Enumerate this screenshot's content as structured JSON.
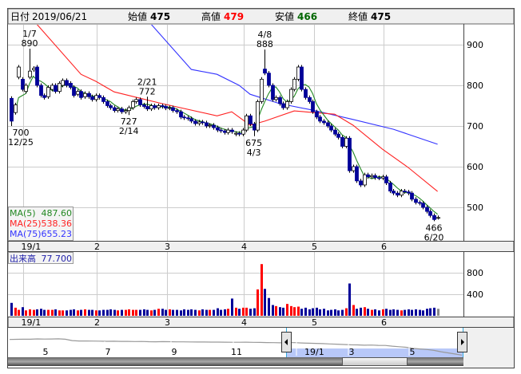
{
  "header": {
    "date_label": "日付",
    "date": "2019/06/21",
    "open_label": "始値",
    "open": "475",
    "high_label": "高値",
    "high": "479",
    "low_label": "安値",
    "low": "466",
    "close_label": "終値",
    "close": "475"
  },
  "colors": {
    "up_candle": "#ffffff",
    "down_candle": "#000099",
    "volume_up": "#ff0000",
    "volume_down": "#000099",
    "volume_flat": "#888888",
    "ma5": "#228822",
    "ma25": "#ff2222",
    "ma75": "#3333ff",
    "high_text": "#ff0000",
    "low_text": "#006600"
  },
  "legend": {
    "ma5_label": "MA(5)",
    "ma5_value": "487.60",
    "ma25_label": "MA(25)",
    "ma25_value": "538.36",
    "ma75_label": "MA(75)",
    "ma75_value": "655.23",
    "volume_label": "出来高",
    "volume_value": "77.700"
  },
  "chart_data": {
    "type": "candlestick",
    "price_axis": {
      "ticks": [
        "900",
        "800",
        "700",
        "600",
        "500"
      ],
      "tick_values": [
        900,
        800,
        700,
        600,
        500
      ],
      "ylim": [
        450,
        945
      ]
    },
    "volume_axis": {
      "ticks": [
        "800",
        "400"
      ],
      "tick_values": [
        800,
        400
      ]
    },
    "months": [
      {
        "label": "19/1",
        "start_index": 4
      },
      {
        "label": "2",
        "start_index": 24
      },
      {
        "label": "3",
        "start_index": 43
      },
      {
        "label": "4",
        "start_index": 64
      },
      {
        "label": "5",
        "start_index": 83
      },
      {
        "label": "6",
        "start_index": 102
      }
    ],
    "open": [
      768,
      733,
      820,
      815,
      785,
      820,
      838,
      845,
      800,
      775,
      772,
      790,
      800,
      785,
      800,
      812,
      805,
      795,
      778,
      785,
      772,
      780,
      772,
      765,
      775,
      770,
      760,
      750,
      745,
      738,
      742,
      735,
      738,
      745,
      760,
      765,
      752,
      748,
      742,
      750,
      745,
      750,
      748,
      744,
      745,
      738,
      735,
      722,
      720,
      718,
      712,
      706,
      710,
      708,
      700,
      702,
      696,
      690,
      688,
      684,
      690,
      680,
      682,
      680,
      690,
      725,
      705,
      690,
      760,
      840,
      830,
      800,
      765,
      770,
      755,
      745,
      760,
      790,
      815,
      845,
      790,
      770,
      760,
      735,
      722,
      712,
      708,
      700,
      690,
      680,
      672,
      650,
      670,
      590,
      600,
      565,
      555,
      580,
      575,
      578,
      573,
      572,
      575,
      560,
      540,
      535,
      530,
      540,
      538,
      535,
      520,
      512,
      510,
      500,
      490,
      480,
      475
    ],
    "close": [
      712,
      752,
      845,
      790,
      800,
      835,
      842,
      800,
      775,
      770,
      795,
      800,
      785,
      805,
      812,
      800,
      795,
      775,
      785,
      770,
      780,
      772,
      765,
      775,
      770,
      760,
      750,
      745,
      738,
      742,
      735,
      738,
      745,
      760,
      765,
      752,
      748,
      742,
      750,
      745,
      750,
      748,
      744,
      745,
      738,
      735,
      722,
      720,
      718,
      712,
      706,
      710,
      708,
      700,
      702,
      696,
      690,
      688,
      684,
      690,
      686,
      682,
      680,
      690,
      725,
      705,
      690,
      760,
      815,
      830,
      800,
      765,
      770,
      755,
      745,
      760,
      790,
      815,
      845,
      790,
      770,
      760,
      735,
      722,
      712,
      708,
      700,
      690,
      680,
      672,
      650,
      670,
      590,
      600,
      565,
      555,
      580,
      575,
      578,
      573,
      572,
      575,
      560,
      540,
      535,
      530,
      540,
      538,
      535,
      520,
      512,
      510,
      500,
      490,
      480,
      470,
      475
    ],
    "extremes": [
      {
        "index": 0,
        "type": "low",
        "value": 700,
        "value_label": "700",
        "date": "12/25"
      },
      {
        "index": 5,
        "type": "high",
        "value": 890,
        "value_label": "890",
        "date": "1/7"
      },
      {
        "index": 32,
        "type": "low",
        "value": 727,
        "value_label": "727",
        "date": "2/14"
      },
      {
        "index": 37,
        "type": "high",
        "value": 772,
        "value_label": "772",
        "date": "2/21"
      },
      {
        "index": 66,
        "type": "low",
        "value": 675,
        "value_label": "675",
        "date": "4/3"
      },
      {
        "index": 69,
        "type": "high",
        "value": 888,
        "value_label": "888",
        "date": "4/8"
      },
      {
        "index": 115,
        "type": "low",
        "value": 466,
        "value_label": "466",
        "date": "6/20"
      }
    ],
    "volume": [
      240,
      150,
      110,
      160,
      100,
      120,
      110,
      120,
      130,
      110,
      110,
      110,
      120,
      100,
      100,
      100,
      110,
      120,
      100,
      110,
      120,
      110,
      110,
      100,
      100,
      110,
      110,
      120,
      110,
      100,
      110,
      110,
      120,
      110,
      110,
      110,
      120,
      110,
      100,
      110,
      130,
      130,
      110,
      120,
      110,
      110,
      100,
      120,
      110,
      120,
      110,
      100,
      120,
      110,
      110,
      110,
      140,
      110,
      120,
      130,
      320,
      150,
      130,
      150,
      150,
      130,
      140,
      490,
      960,
      500,
      330,
      200,
      180,
      160,
      150,
      220,
      180,
      160,
      170,
      130,
      150,
      120,
      140,
      150,
      120,
      130,
      100,
      110,
      120,
      100,
      110,
      140,
      600,
      200,
      130,
      150,
      160,
      130,
      110,
      120,
      100,
      120,
      130,
      110,
      120,
      110,
      100,
      110,
      120,
      110,
      120,
      110,
      100,
      130,
      140,
      150,
      130
    ],
    "ma25": [
      [
        3,
        990
      ],
      [
        7,
        950
      ],
      [
        19,
        827
      ],
      [
        23,
        810
      ],
      [
        28,
        784
      ],
      [
        41,
        755
      ],
      [
        56,
        725
      ],
      [
        60,
        735
      ],
      [
        65,
        702
      ],
      [
        69,
        712
      ],
      [
        77,
        737
      ],
      [
        88,
        729
      ],
      [
        93,
        702
      ],
      [
        101,
        643
      ],
      [
        108,
        598
      ],
      [
        116,
        539
      ]
    ],
    "ma75": [
      [
        36,
        960
      ],
      [
        38,
        951
      ],
      [
        49,
        839
      ],
      [
        56,
        827
      ],
      [
        62,
        800
      ],
      [
        65,
        778
      ],
      [
        73,
        755
      ],
      [
        82,
        739
      ],
      [
        93,
        716
      ],
      [
        104,
        692
      ],
      [
        116,
        655
      ]
    ]
  },
  "navigator": {
    "labels": [
      "5",
      "7",
      "9",
      "11",
      "19/1",
      "3",
      "5"
    ],
    "series": [
      1040,
      1045,
      1050,
      1048,
      1060,
      1055,
      1058,
      1062,
      1050,
      1000,
      985,
      985,
      982,
      980,
      975,
      978,
      972,
      970,
      965,
      968,
      960,
      958,
      962,
      960,
      955,
      955,
      952,
      950,
      948,
      945,
      945,
      942,
      940,
      940,
      942,
      938,
      935,
      930,
      925,
      920,
      930,
      925,
      915,
      905,
      900,
      890,
      880,
      870,
      860,
      850,
      845,
      835,
      840,
      830,
      825,
      800,
      780,
      760,
      720,
      700,
      680,
      650,
      600,
      560,
      520,
      480
    ],
    "selection_start_label": "19/1"
  }
}
